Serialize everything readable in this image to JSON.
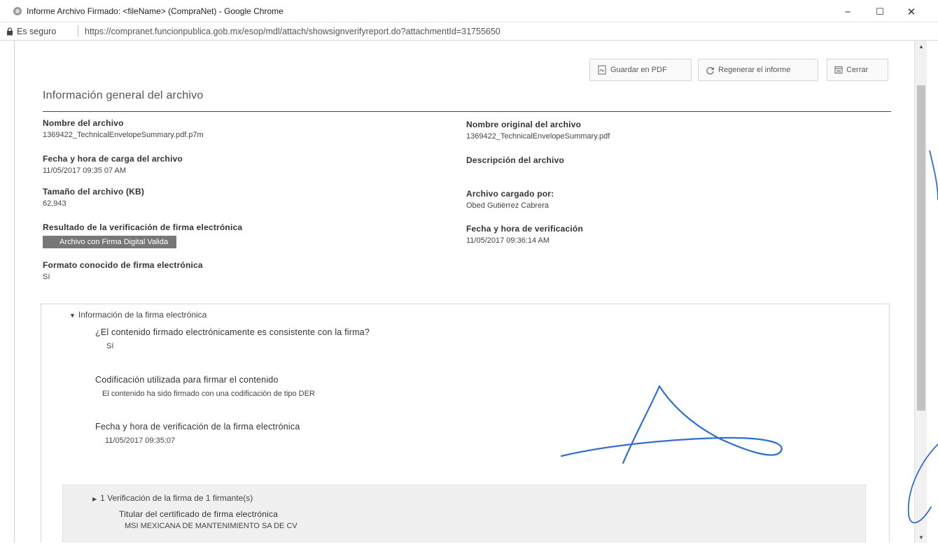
{
  "window": {
    "title": "Informe Archivo Firmado: <fileName> (CompraNet) - Google Chrome",
    "minimize_glyph": "−",
    "maximize_glyph": "☐",
    "close_glyph": "✕"
  },
  "addressbar": {
    "secure_label": "Es seguro",
    "url": "https://compranet.funcionpublica.gob.mx/esop/mdl/attach/showsignverifyreport.do?attachmentId=31755650"
  },
  "toolbar": {
    "save_pdf_label": "Guardar en PDF",
    "regenerate_label": "Regenerar el informe",
    "close_label": "Cerrar"
  },
  "general": {
    "title": "Información general del archivo",
    "file_name_label": "Nombre del archivo",
    "file_name_value": "1369422_TechnicalEnvelopeSummary.pdf.p7m",
    "original_name_label": "Nombre original del archivo",
    "original_name_value": "1369422_TechnicalEnvelopeSummary.pdf",
    "upload_date_label": "Fecha y hora de carga del archivo",
    "upload_date_value": "11/05/2017 09:35 07 AM",
    "description_label": "Descripción del archivo",
    "size_label": "Tamaño del archivo (KB)",
    "size_value": "62,943",
    "uploaded_by_label": "Archivo cargado por:",
    "uploaded_by_value": "Obed Gutiérrez Cabrera",
    "verification_result_label": "Resultado de la verificación de firma electrónica",
    "verification_result_badge": "Archivo con Firma Digital Valida",
    "verification_date_label": "Fecha y hora de verificación",
    "verification_date_value": "11/05/2017 09:36:14 AM",
    "known_format_label": "Formato conocido de firma electrónica",
    "known_format_value": "Sí"
  },
  "signature_info": {
    "header": "Información de la firma electrónica",
    "consistent_label": "¿El contenido firmado electrónicamente es consistente con la firma?",
    "consistent_value": "Sí",
    "encoding_label": "Codificación utilizada para firmar el contenido",
    "encoding_value": "El contenido ha sido firmado con una codificación de tipo DER",
    "sign_date_label": "Fecha y hora de verificación de la firma electrónica",
    "sign_date_value": "11/05/2017 09:35:07",
    "signers": {
      "header": "1 Verificación de la firma de 1 firmante(s)",
      "holder_label": "Titular del certificado de firma electrónica",
      "holder_value": "MSI MEXICANA DE MANTENIMIENTO SA DE CV"
    }
  },
  "colors": {
    "badge_bg": "#777777",
    "signature_ink": "#2f6fd1",
    "rule": "#444444"
  },
  "icons": {
    "favicon": "chrome-page-icon",
    "lock": "lock-icon",
    "pdf": "pdf-icon",
    "refresh": "refresh-icon",
    "close_doc": "close-doc-icon"
  }
}
